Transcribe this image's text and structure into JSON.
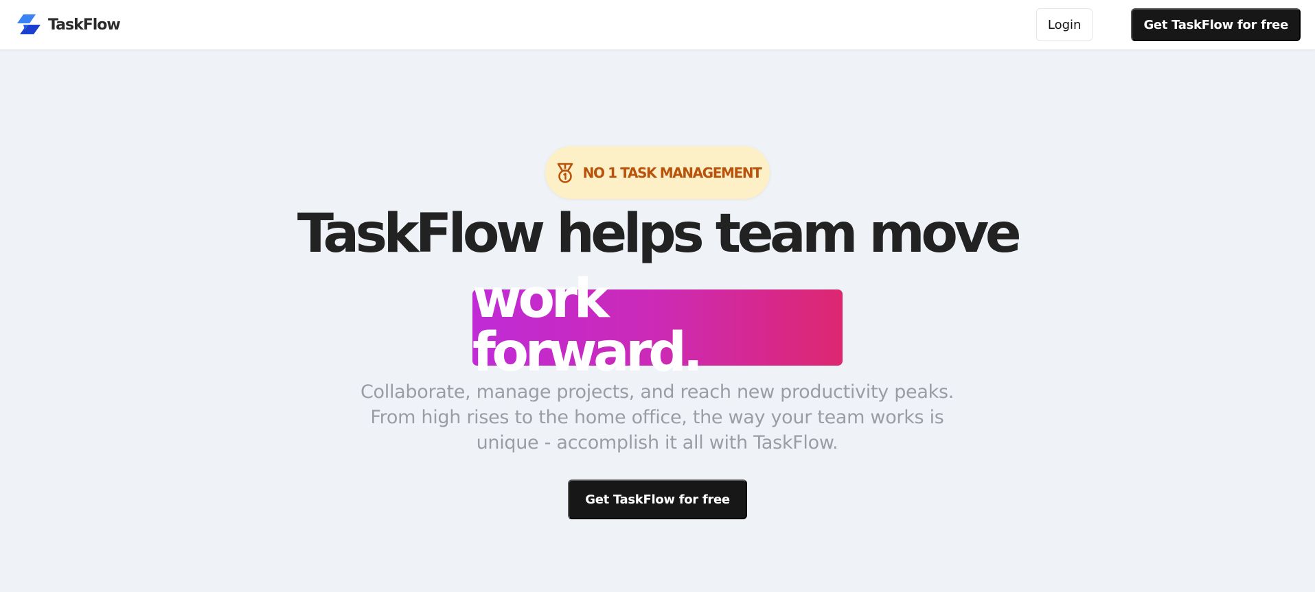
{
  "navbar": {
    "brand_name": "TaskFlow",
    "logo_icon": "taskflow-logo-icon",
    "login_label": "Login",
    "cta_label": "Get TaskFlow for free"
  },
  "hero": {
    "badge_icon": "medal-icon",
    "badge_text": "NO 1 TASK MANAGEMENT",
    "headline": "TaskFlow helps team move",
    "highlight_text": "work forward.",
    "subtext": "Collaborate, manage projects, and reach new productivity peaks. From high rises to the home office, the way your team works is unique - accomplish it all with TaskFlow.",
    "cta_label": "Get TaskFlow for free"
  },
  "colors": {
    "page_background": "#eff3f8",
    "navbar_background": "#ffffff",
    "brand_blue": "#2563eb",
    "badge_background": "#fdf0c6",
    "badge_text": "#b9520b",
    "highlight_gradient_start": "#c02bd6",
    "highlight_gradient_end": "#dd2770",
    "button_dark": "#171717",
    "headline": "#222222",
    "subtext": "#9a9ea4"
  }
}
